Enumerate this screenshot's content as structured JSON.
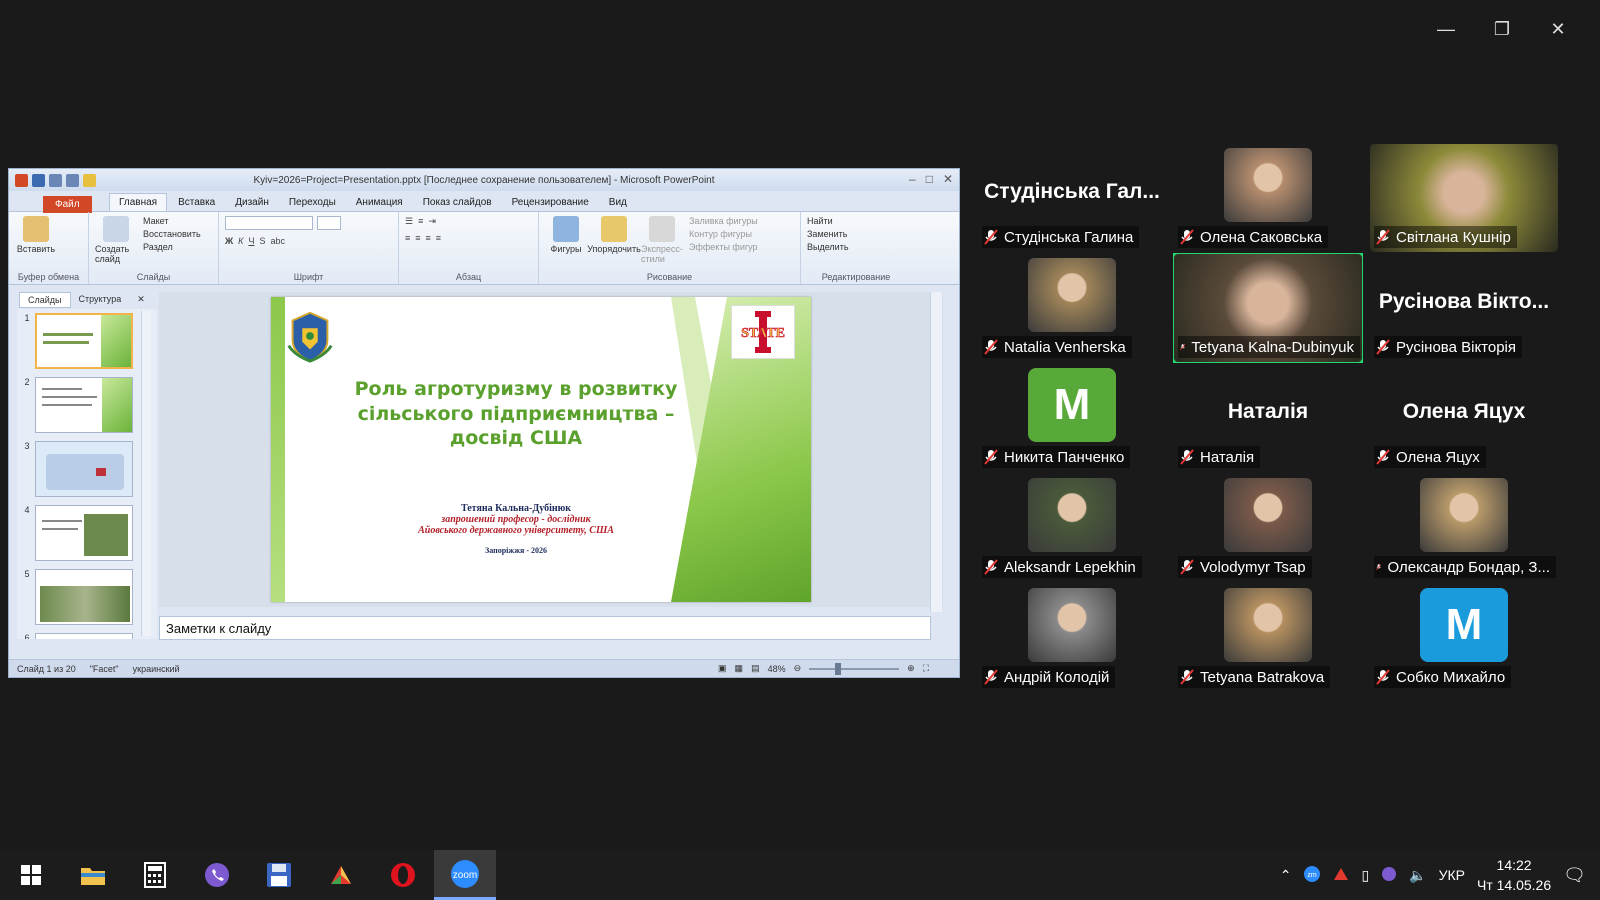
{
  "ppt": {
    "title": "Kyiv=2026=Project=Presentation.pptx [Последнее сохранение пользователем] - Microsoft PowerPoint",
    "file_tab": "Файл",
    "tabs": [
      "Главная",
      "Вставка",
      "Дизайн",
      "Переходы",
      "Анимация",
      "Показ слайдов",
      "Рецензирование",
      "Вид"
    ],
    "groups": {
      "clipboard": {
        "label": "Буфер обмена",
        "paste": "Вставить"
      },
      "slides": {
        "label": "Слайды",
        "new": "Создать слайд",
        "layout": "Макет",
        "reset": "Восстановить",
        "section": "Раздел"
      },
      "font": {
        "label": "Шрифт"
      },
      "paragraph": {
        "label": "Абзац"
      },
      "drawing": {
        "label": "Рисование",
        "shapes": "Фигуры",
        "arrange": "Упорядочить",
        "styles": "Экспресс-стили",
        "fill": "Заливка фигуры",
        "outline": "Контур фигуры",
        "effects": "Эффекты фигур"
      },
      "editing": {
        "label": "Редактирование",
        "find": "Найти",
        "replace": "Заменить",
        "select": "Выделить"
      }
    },
    "panel_tabs": [
      "Слайды",
      "Структура"
    ],
    "slide_numbers": [
      "1",
      "2",
      "3",
      "4",
      "5",
      "6"
    ],
    "slide": {
      "title": "Роль агротуризму в розвитку сільського підприємництва – досвід США",
      "author": "Тетяна Кальна-Дубінюк",
      "role": "запрошений професор - дослідник",
      "university": "Айовського державного університету, США",
      "city": "Запоріжжя - 2026",
      "logo_text": "STATE"
    },
    "notes_placeholder": "Заметки к слайду",
    "status": {
      "slide": "Слайд 1 из 20",
      "theme": "\"Facet\"",
      "lang": "украинский",
      "zoom": "48%"
    }
  },
  "participants": [
    {
      "name": "Студінська Галина",
      "display": "Студінська Гал...",
      "type": "name"
    },
    {
      "name": "Олена Саковська",
      "type": "photo",
      "color": "#b58d6e"
    },
    {
      "name": "Світлана Кушнір",
      "type": "video",
      "color": "#8d8a3a"
    },
    {
      "name": "Natalia Venherska",
      "type": "photo",
      "color": "#a0855a"
    },
    {
      "name": "Tetyana Kalna-Dubinyuk",
      "type": "video",
      "color": "#5a4a3a",
      "active": true
    },
    {
      "name": "Русінова Вікторія",
      "display": "Русінова Вікто...",
      "type": "name"
    },
    {
      "name": "Никита Панченко",
      "type": "letter",
      "letter": "M",
      "color": "#58a83a"
    },
    {
      "name": "Наталія",
      "display": "Наталія",
      "type": "name"
    },
    {
      "name": "Олена Яцух",
      "display": "Олена Яцух",
      "type": "name"
    },
    {
      "name": "Aleksandr Lepekhin",
      "type": "photo",
      "color": "#4a5a3a"
    },
    {
      "name": "Volodymyr Tsap",
      "type": "photo",
      "color": "#7a5a4a"
    },
    {
      "name": "Олександр Бондар, З...",
      "type": "photo",
      "color": "#b89a6a"
    },
    {
      "name": "Андрій Колодій",
      "type": "photo",
      "color": "#8a8a8a"
    },
    {
      "name": "Tetyana Batrakova",
      "type": "photo",
      "color": "#b59060"
    },
    {
      "name": "Собко Михайло",
      "type": "letter",
      "letter": "M",
      "color": "#1a9bdc"
    }
  ],
  "taskbar": {
    "icons": [
      "windows-start",
      "file-explorer",
      "calculator",
      "viber",
      "save-app",
      "app",
      "opera",
      "zoom"
    ],
    "tray": {
      "lang": "УКР",
      "time": "14:22",
      "date": "Чт 14.05.26"
    }
  }
}
